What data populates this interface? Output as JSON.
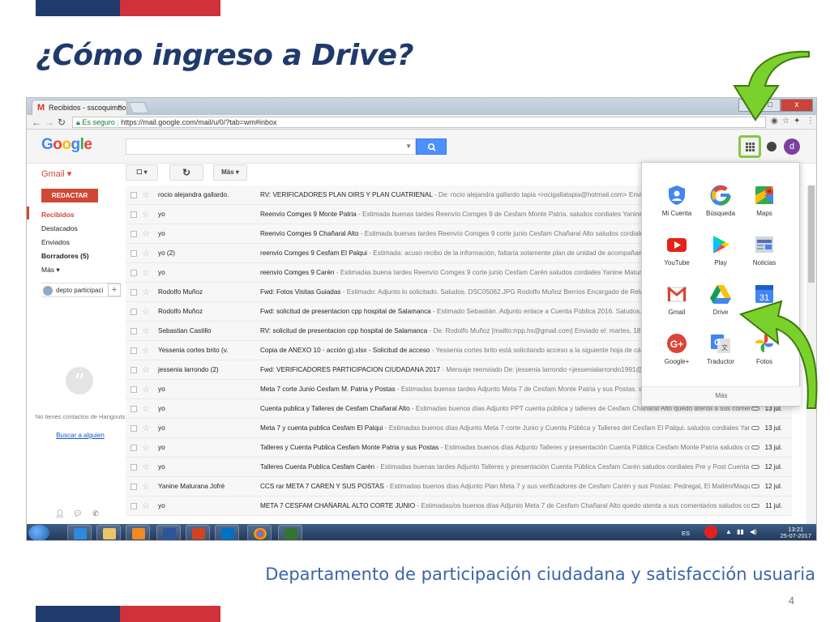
{
  "slide": {
    "title": "¿Cómo ingreso a Drive?",
    "footer": "Departamento de participación ciudadana y satisfacción usuaria",
    "page_number": "4",
    "colors": {
      "blue": "#1f3a6b",
      "red": "#d0313a",
      "accent_green": "#7bd12b"
    }
  },
  "browser": {
    "tab_title": "Recibidos - sscoquimbo.",
    "tab_close": "×",
    "secure_label": "Es seguro",
    "url": "https://mail.google.com/mail/u/0/?tab=wm#inbox",
    "window_buttons": [
      "–",
      "□",
      "x"
    ]
  },
  "google": {
    "logo": "Google",
    "search_value": "",
    "account_initial": "d"
  },
  "gmail": {
    "label": "Gmail ▾",
    "compose": "REDACTAR",
    "toolbar": {
      "select": "☐ ▾",
      "refresh": "↻",
      "more": "Más ▾"
    },
    "nav": [
      {
        "label": "Recibidos",
        "style": "active"
      },
      {
        "label": "Destacados",
        "style": ""
      },
      {
        "label": "Enviados",
        "style": ""
      },
      {
        "label": "Borradores (5)",
        "style": "bold"
      },
      {
        "label": "Más ▾",
        "style": ""
      }
    ],
    "hangouts": {
      "me": "depto participaci",
      "empty_text": "No tienes contactos de Hangouts",
      "link": "Buscar a alguien"
    },
    "messages": [
      {
        "sender": "rocio alejandra gallardo.",
        "subject": "RV: VERIFICADORES PLAN OIRS Y PLAN CUATRIENAL",
        "snippet": " - De: rocio alejandra gallardo tapia <rocigallatapia@hotmail.com> Enviado: vi",
        "date": ""
      },
      {
        "sender": "yo",
        "subject": "Reenvío Comges 9 Monte Patria",
        "snippet": " - Estimada buenas tardes Reenvío Comges 9 de Cesfam Monte Patria. saludos cordiales Yanine M",
        "date": ""
      },
      {
        "sender": "yo",
        "subject": "Reenvío Comges 9 Chañaral Alto",
        "snippet": " - Estimada buenas tardes Reenvío Comges 9 corte junio Cesfam Chañaral Alto saludos cordiales Y",
        "date": ""
      },
      {
        "sender": "yo (2)",
        "subject": "reenvío Comges 9 Cesfam El Palqui",
        "snippet": " - Estimada: acuso recibo de la información, faltaría solamente plan de unidad de acompañamiento e",
        "date": ""
      },
      {
        "sender": "yo",
        "subject": "reenvío Comges 9 Carén",
        "snippet": " - Estimadas buena tardes Reenvío Comges 9 corte junio Cesfam Carén saludos cordiales Yanine Maturana Jo",
        "date": ""
      },
      {
        "sender": "Rodolfo Muñoz",
        "subject": "Fwd: Fotos Visitas Guiadas",
        "snippet": " - Estimado: Adjunto lo solicitado. Saludos. DSC05062.JPG Rodolfo Muñoz Berríos Encargado de Relacion",
        "date": ""
      },
      {
        "sender": "Rodolfo Muñoz",
        "subject": "Fwd: solicitud de presentacion cpp hospital de Salamanca",
        "snippet": " - Estimado Sebastián. Adjunto enlace a Cuenta Pública 2016. Saludos. Cuen",
        "date": ""
      },
      {
        "sender": "Sebastian Castillo",
        "subject": "RV: solicitud de presentacion cpp hospital de Salamanca",
        "snippet": " - De: Rodolfo Muñoz [mailto:rrpp.hs@gmail.com] Enviado el: martes, 18 de julio",
        "date": ""
      },
      {
        "sender": "Yessenia cortes brito (v.",
        "subject": "Copia de ANEXO 10 - acción g).xlsx - Solicitud de acceso",
        "snippet": " - Yessenia cortes brito está solicitando acceso a la siguiente hoja de cálculo: C",
        "date": ""
      },
      {
        "sender": "jessenia larrondo (2)",
        "subject": "Fwd: VERIFICADORES PARTICIPACION CIUDADANA 2017",
        "snippet": " - Mensaje reenviado De: jessenia larrondo <jessenialarrondo1991@gmail.com",
        "date": ""
      },
      {
        "sender": "yo",
        "subject": "Meta 7 corte Junio Cesfam M. Patria y Postas",
        "snippet": " - Estimadas buenas tardes Adjunto Meta 7 de Cesfam Monte Patria y sus Postas. saludos cordi",
        "date": ""
      },
      {
        "sender": "yo",
        "subject": "Cuenta publica y Talleres de Cesfam Chañaral Alto",
        "snippet": " - Estimadas buenos días Adjunto PPT cuenta pública y talleres de Cesfam Chañaral Alto quedo atenta a sus comentarios s",
        "date": "13 jul."
      },
      {
        "sender": "yo",
        "subject": "Meta 7 y cuenta publica Cesfam El Palqui",
        "snippet": " - Estimadas buenos días Adjunto Meta 7 corte Junio y Cuenta Pública y Talleres del Cesfam El Palqui. saludos cordiales Yanine Mat",
        "date": "13 jul."
      },
      {
        "sender": "yo",
        "subject": "Talleres y Cuenta Publica Cesfam Monte Patria y sus Postas",
        "snippet": " - Estimadas buenos días Adjunto Talleres y presentación Cuenta Pública Cesfam Monte Patria saludos cordiales",
        "date": "13 jul."
      },
      {
        "sender": "yo",
        "subject": "Talleres Cuenta Publica Cesfam Carén",
        "snippet": " - Estimadas buenas tardes Adjunto Talleres y presentación Cuenta Pública Cesfam Carén saludos cordiales Pre y Post Cuenta Públic",
        "date": "12 jul."
      },
      {
        "sender": "Yanine Maturana Jofré",
        "subject": "CCS rar META 7 CAREN Y SUS POSTAS",
        "snippet": " - Estimadas buenos días Adjunto Plan Meta 7 y sus verificadores de Cesfam Carén y sus Postas: Pedregal, El Maitén/Maqui, Tulah",
        "date": "12 jul."
      },
      {
        "sender": "yo",
        "subject": "META 7 CESFAM CHAÑARAL ALTO CORTE JUNIO",
        "snippet": " - Estimadas/os buenos días Adjunto Meta 7 de Cesfam Chañaral Alto quedo atenta a sus comentarios saludos cordiales",
        "date": "11 jul."
      }
    ]
  },
  "apps_menu": {
    "apps": [
      {
        "label": "Mi Cuenta",
        "icon": "account-shield-icon",
        "color": "#4285f4"
      },
      {
        "label": "Búsqueda",
        "icon": "google-g-icon",
        "color": "#ea4335"
      },
      {
        "label": "Maps",
        "icon": "maps-icon",
        "color": "#34a853"
      },
      {
        "label": "YouTube",
        "icon": "youtube-icon",
        "color": "#e62117"
      },
      {
        "label": "Play",
        "icon": "play-icon",
        "color": "#00c4ff"
      },
      {
        "label": "Noticias",
        "icon": "news-icon",
        "color": "#5c6bc0"
      },
      {
        "label": "Gmail",
        "icon": "gmail-icon",
        "color": "#db4437"
      },
      {
        "label": "Drive",
        "icon": "drive-icon",
        "color": "#0f9d58"
      },
      {
        "label": "31",
        "icon": "calendar-icon",
        "color": "#4285f4"
      },
      {
        "label": "Google+",
        "icon": "google-plus-icon",
        "color": "#db4437"
      },
      {
        "label": "Traductor",
        "icon": "translate-icon",
        "color": "#4285f4"
      },
      {
        "label": "Fotos",
        "icon": "photos-icon",
        "color": "#f4b400"
      }
    ],
    "more": "Más"
  },
  "taskbar": {
    "language": "ES",
    "time": "13:21",
    "date": "25-07-2017"
  }
}
